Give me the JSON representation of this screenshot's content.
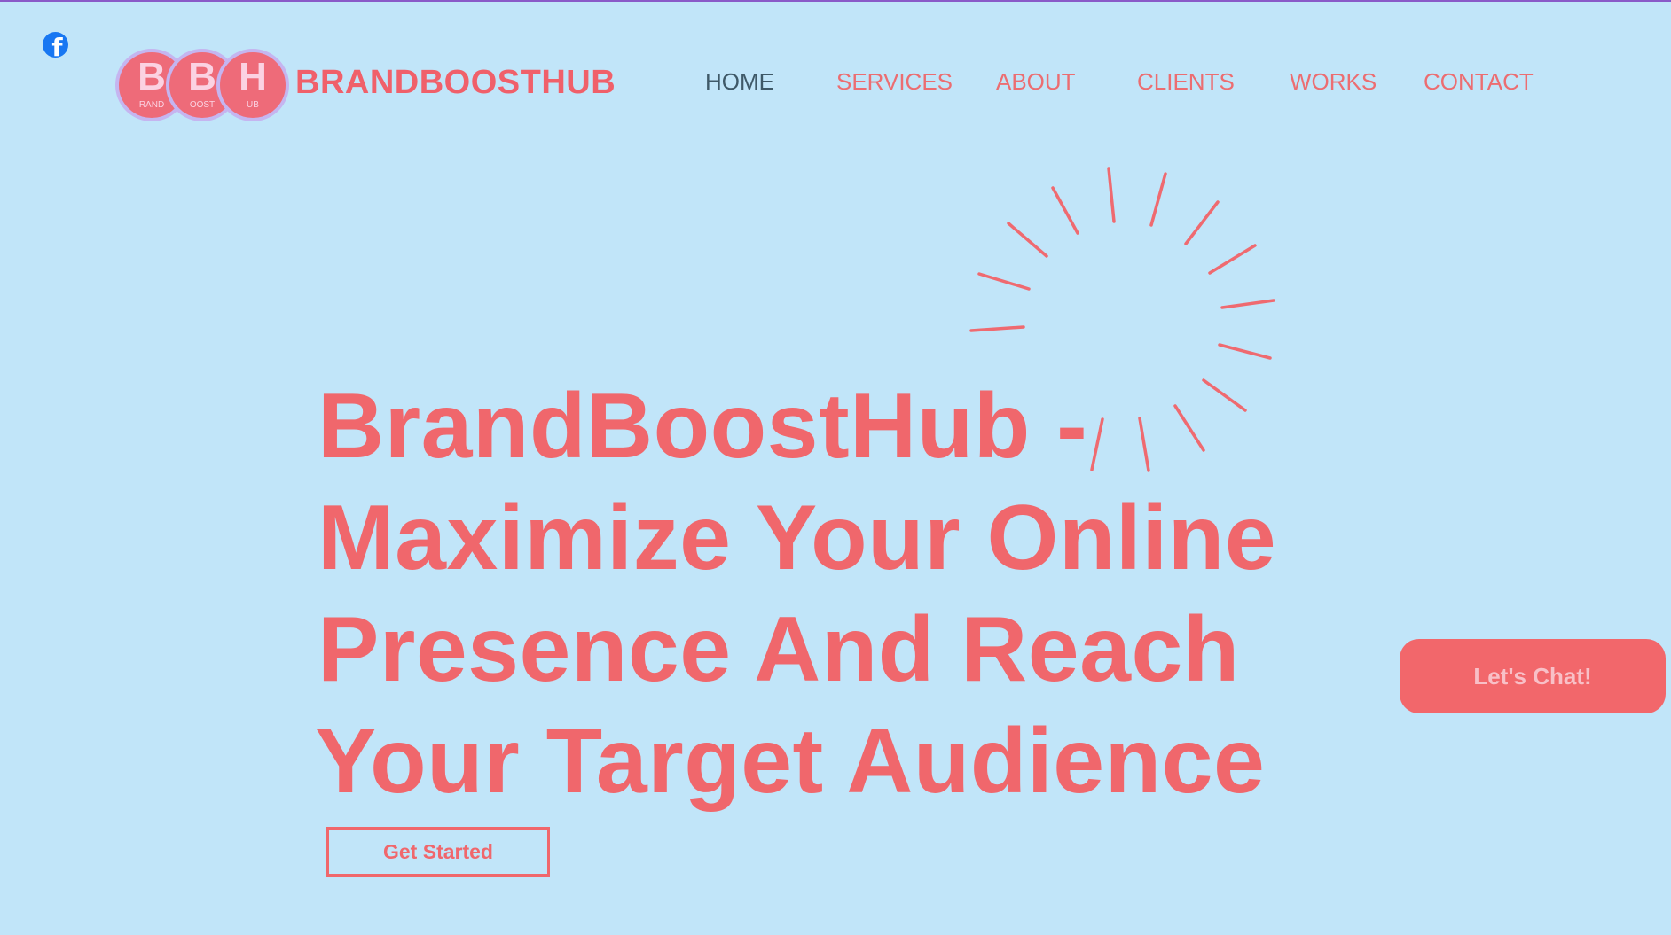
{
  "header": {
    "social": {
      "icon": "facebook-icon",
      "glyph": "f"
    },
    "logo": {
      "letters": [
        {
          "big": "B",
          "small": "RAND"
        },
        {
          "big": "B",
          "small": "OOST"
        },
        {
          "big": "H",
          "small": "UB"
        }
      ]
    },
    "brand_name": "BRANDBOOSTHUB"
  },
  "nav": {
    "items": [
      {
        "label": "HOME",
        "active": true
      },
      {
        "label": "SERVICES",
        "active": false
      },
      {
        "label": "ABOUT",
        "active": false
      },
      {
        "label": "CLIENTS",
        "active": false
      },
      {
        "label": "WORKS",
        "active": false
      },
      {
        "label": "CONTACT",
        "active": false
      }
    ]
  },
  "hero": {
    "lines": [
      "BrandBoostHub -",
      "Maximize Your Online",
      "Presence And Reach",
      "Your Target Audience"
    ],
    "cta_label": "Get Started"
  },
  "chat": {
    "label": "Let's Chat!"
  },
  "colors": {
    "background": "#c1e5f9",
    "accent": "#f0676c",
    "nav_active": "#3f5968",
    "facebook": "#1877f2"
  }
}
